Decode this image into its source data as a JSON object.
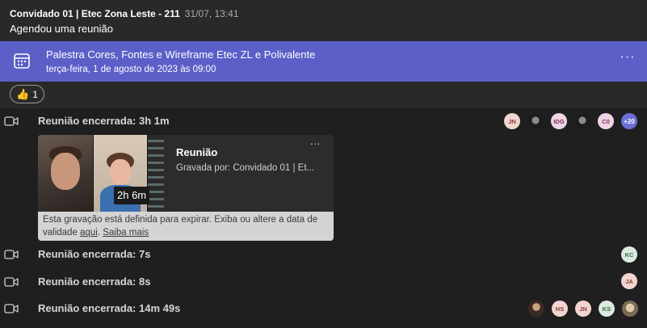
{
  "message": {
    "author": "Convidado 01 | Etec Zona Leste - 211",
    "time": "31/07, 13:41",
    "text": "Agendou uma reunião"
  },
  "meeting_card": {
    "title": "Palestra Cores, Fontes e Wireframe Etec ZL e Polivalente",
    "date": "terça-feira, 1 de agosto de 2023 às 09:00",
    "more": "···",
    "color": "#5b5fc7"
  },
  "reaction": {
    "emoji": "👍",
    "count": "1"
  },
  "meetings": [
    {
      "label": "Reunião encerrada: 3h 1m",
      "participants": [
        "JN",
        "",
        "IDG",
        "",
        "C0",
        "+20"
      ]
    },
    {
      "label": "Reunião encerrada: 7s",
      "participants": [
        "KC"
      ]
    },
    {
      "label": "Reunião encerrada: 8s",
      "participants": [
        "JA"
      ]
    },
    {
      "label": "Reunião encerrada: 14m 49s",
      "participants": [
        "",
        "HS",
        "JN",
        "KS",
        ""
      ]
    }
  ],
  "recording": {
    "title": "Reunião",
    "recorded_by": "Gravada por: Convidado 01 | Et...",
    "duration": "2h 6m",
    "more": "···",
    "expire_text": "Esta gravação está definida para expirar. Exiba ou altere a data de validade ",
    "link_here": "aqui",
    "separator": ".",
    "link_more": "Saiba mais"
  }
}
